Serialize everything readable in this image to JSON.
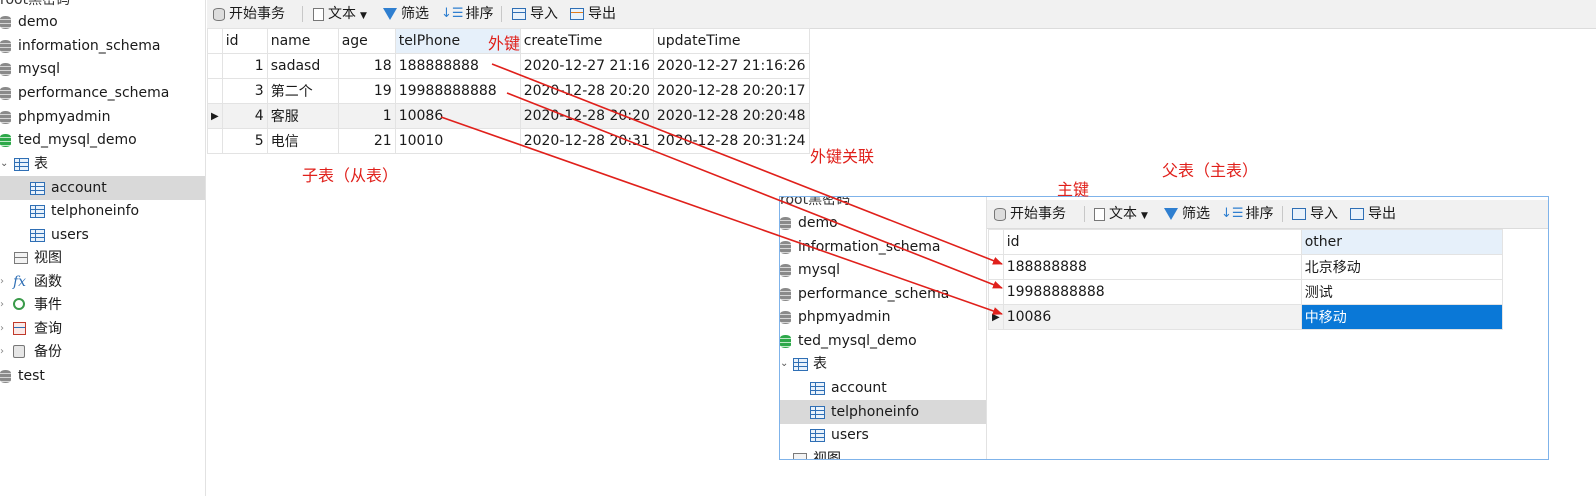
{
  "left_tree": {
    "connection": "root黑密码",
    "items": [
      {
        "label": "demo"
      },
      {
        "label": "information_schema"
      },
      {
        "label": "mysql"
      },
      {
        "label": "performance_schema"
      },
      {
        "label": "phpmyadmin"
      },
      {
        "label": "ted_mysql_demo"
      }
    ],
    "tables_node": "表",
    "tables": [
      {
        "label": "account"
      },
      {
        "label": "telphoneinfo"
      },
      {
        "label": "users"
      }
    ],
    "views_node": "视图",
    "functions_node": "函数",
    "events_node": "事件",
    "queries_node": "查询",
    "backups_node": "备份",
    "test_db": "test"
  },
  "main_toolbar": {
    "begin_transaction": "开始事务",
    "text": "文本",
    "filter": "筛选",
    "sort": "排序",
    "import": "导入",
    "export": "导出"
  },
  "child_grid": {
    "columns": [
      "id",
      "name",
      "age",
      "telPhone",
      "createTime",
      "updateTime"
    ],
    "rows": [
      [
        "1",
        "sadasd",
        "18",
        "188888888",
        "2020-12-27 21:16",
        "2020-12-27 21:16:26"
      ],
      [
        "3",
        "第二个",
        "19",
        "19988888888",
        "2020-12-28 20:20",
        "2020-12-28 20:20:17"
      ],
      [
        "4",
        "客服",
        "1",
        "10086",
        "2020-12-28 20:20",
        "2020-12-28 20:20:48"
      ],
      [
        "5",
        "电信",
        "21",
        "10010",
        "2020-12-28 20:31",
        "2020-12-28 20:31:24"
      ]
    ]
  },
  "inset": {
    "tree": {
      "connection": "root黑密码",
      "items": [
        {
          "label": "demo"
        },
        {
          "label": "information_schema"
        },
        {
          "label": "mysql"
        },
        {
          "label": "performance_schema"
        },
        {
          "label": "phpmyadmin"
        },
        {
          "label": "ted_mysql_demo"
        }
      ],
      "tables_node": "表",
      "tables": [
        {
          "label": "account"
        },
        {
          "label": "telphoneinfo"
        },
        {
          "label": "users"
        }
      ],
      "views_node": "视图"
    },
    "toolbar": {
      "begin_transaction": "开始事务",
      "text": "文本",
      "filter": "筛选",
      "sort": "排序",
      "import": "导入",
      "export": "导出"
    },
    "grid": {
      "columns": [
        "id",
        "other"
      ],
      "rows": [
        [
          "188888888",
          "北京移动"
        ],
        [
          "19988888888",
          "测试"
        ],
        [
          "10086",
          "中移动"
        ]
      ]
    }
  },
  "annotations": {
    "foreign_key": "外键",
    "child_table": "子表（从表）",
    "fk_relation": "外键关联",
    "primary_key": "主键",
    "parent_table": "父表（主表）"
  },
  "colors": {
    "annotation": "#e0201b",
    "selection": "#0a78d7",
    "tree_selected": "#d9d9d9",
    "db_active": "#2ea84a"
  }
}
